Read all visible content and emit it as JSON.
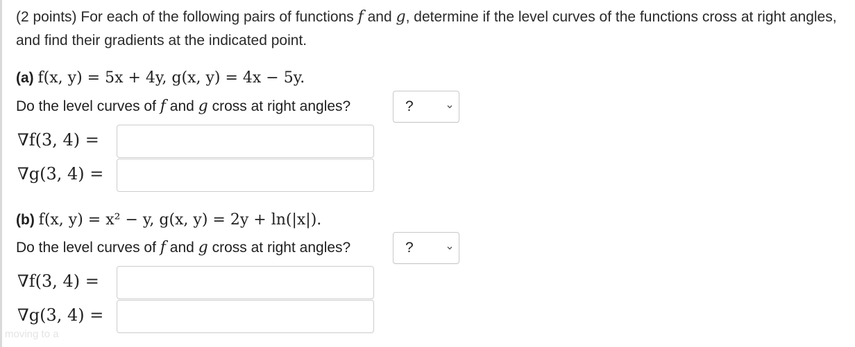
{
  "intro": {
    "prefix": "(2 points) For each of the following pairs of functions",
    "f": "f",
    "and": "and",
    "g": "g",
    "suffix": ", determine if the level curves of the functions cross at right angles, and find their gradients at the indicated point."
  },
  "parts": [
    {
      "label": "(a)",
      "equation": "f(x, y) = 5x + 4y, g(x, y) = 4x − 5y.",
      "question_prefix": "Do the level curves of",
      "question_f": "f",
      "question_and": "and",
      "question_g": "g",
      "question_suffix": "cross at right angles?",
      "select_value": "?",
      "grad_f_label": "∇f(3, 4) =",
      "grad_g_label": "∇g(3, 4) =",
      "grad_f_value": "",
      "grad_g_value": ""
    },
    {
      "label": "(b)",
      "equation": "f(x, y) = x² − y, g(x, y) = 2y + ln(|x|).",
      "question_prefix": "Do the level curves of",
      "question_f": "f",
      "question_and": "and",
      "question_g": "g",
      "question_suffix": "cross at right angles?",
      "select_value": "?",
      "grad_f_label": "∇f(3, 4) =",
      "grad_g_label": "∇g(3, 4) =",
      "grad_f_value": "",
      "grad_g_value": ""
    }
  ],
  "ghost_text": "moving to a"
}
